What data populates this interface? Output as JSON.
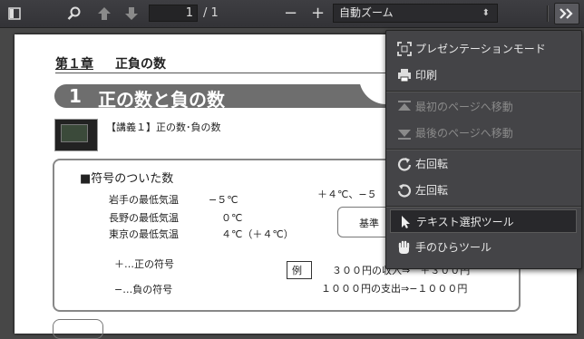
{
  "toolbar": {
    "page_current": "1",
    "page_total": "/ 1",
    "zoom_label": "自動ズーム",
    "zoom_minus": "−",
    "zoom_plus": "+"
  },
  "document": {
    "chapter_label": "第１章",
    "chapter_title": "正負の数",
    "section_number": "1",
    "section_title": "正の数と負の数",
    "lecture_label": "【講義１】正の数･負の数",
    "box_heading": "■符号のついた数",
    "temps": [
      {
        "place": "岩手の最低気温",
        "value": "−５℃"
      },
      {
        "place": "長野の最低気温",
        "value": "０℃"
      },
      {
        "place": "東京の最低気温",
        "value": "４℃（＋４℃）"
      }
    ],
    "plus_four_text": "＋４℃、−５",
    "basis_button": "基準",
    "plus_sign_text": "＋…正の符号",
    "minus_sign_text": "−…負の符号",
    "example_label": "例",
    "income_text": "３００円の収入⇒　＋３００円",
    "expense_text": "１０００円の支出⇒−１０００円"
  },
  "menu": {
    "items": [
      {
        "label": "プレゼンテーションモード",
        "icon": "fullscreen-icon",
        "disabled": false
      },
      {
        "label": "印刷",
        "icon": "print-icon",
        "disabled": false
      },
      {
        "label": "最初のページへ移動",
        "icon": "first-page-icon",
        "disabled": true
      },
      {
        "label": "最後のページへ移動",
        "icon": "last-page-icon",
        "disabled": true
      },
      {
        "label": "右回転",
        "icon": "rotate-cw-icon",
        "disabled": false
      },
      {
        "label": "左回転",
        "icon": "rotate-ccw-icon",
        "disabled": false
      },
      {
        "label": "テキスト選択ツール",
        "icon": "cursor-icon",
        "disabled": false,
        "selected": true
      },
      {
        "label": "手のひらツール",
        "icon": "hand-icon",
        "disabled": false
      }
    ]
  }
}
